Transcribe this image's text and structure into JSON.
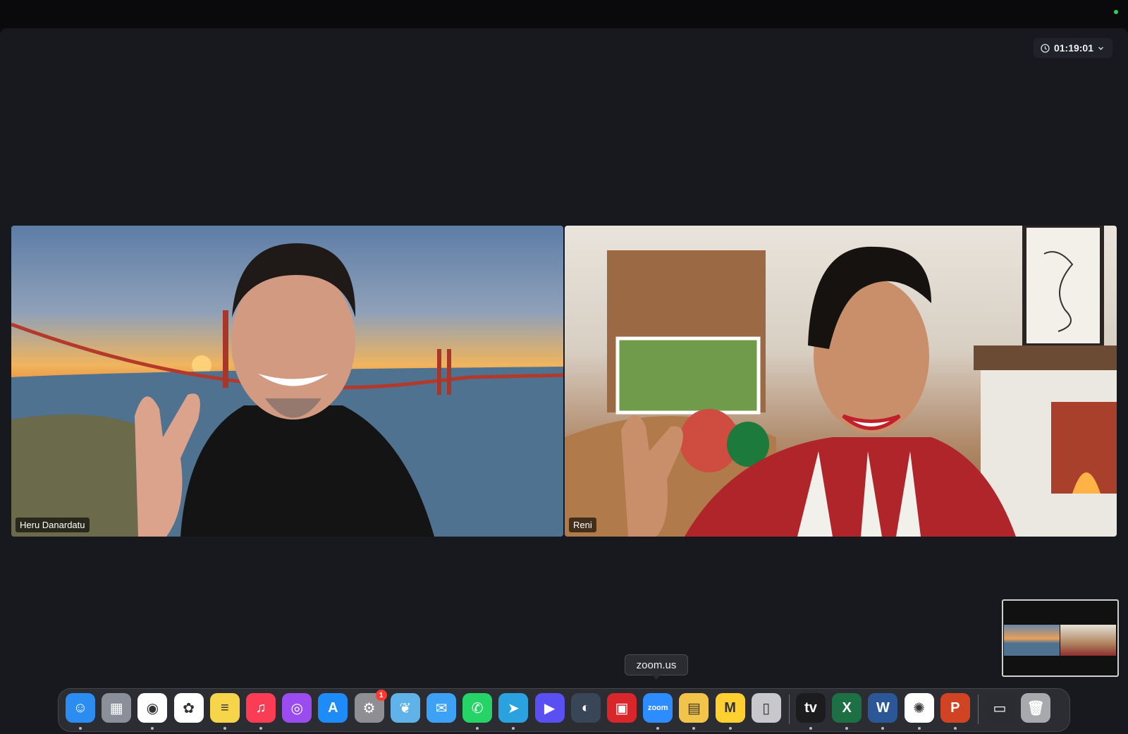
{
  "meeting": {
    "timer": "01:19:01"
  },
  "participants": [
    {
      "name": "Heru Danardatu"
    },
    {
      "name": "Reni"
    }
  ],
  "dock": {
    "tooltip": "zoom.us",
    "settings_badge": "1",
    "zoom_label": "zoom",
    "items": [
      {
        "name": "finder-icon",
        "color": "#2b8cf2"
      },
      {
        "name": "launchpad-icon",
        "color": "#8a8f99"
      },
      {
        "name": "chrome-icon",
        "color": "#ffffff"
      },
      {
        "name": "photos-icon",
        "color": "#ffffff"
      },
      {
        "name": "notes-icon",
        "color": "#f7d54a"
      },
      {
        "name": "music-icon",
        "color": "#fa3c55"
      },
      {
        "name": "podcasts-icon",
        "color": "#9b4cf0"
      },
      {
        "name": "app-store-icon",
        "color": "#1d8cf8"
      },
      {
        "name": "system-settings-icon",
        "color": "#8e8e93"
      },
      {
        "name": "kindle-icon",
        "color": "#5fb3e8"
      },
      {
        "name": "mail-icon",
        "color": "#3da2f5"
      },
      {
        "name": "whatsapp-icon",
        "color": "#25d366"
      },
      {
        "name": "telegram-icon",
        "color": "#2aa2e0"
      },
      {
        "name": "linear-icon",
        "color": "#5a4ff2"
      },
      {
        "name": "quicktime-icon",
        "color": "#384657"
      },
      {
        "name": "photo-booth-icon",
        "color": "#d9262b"
      },
      {
        "name": "zoom-icon",
        "color": "#2d8cff"
      },
      {
        "name": "stickies-icon",
        "color": "#f3c44a"
      },
      {
        "name": "miro-icon",
        "color": "#ffd02f"
      },
      {
        "name": "iphone-mirroring-icon",
        "color": "#c7c7cc"
      },
      {
        "name": "apple-tv-icon",
        "color": "#1c1c1e"
      },
      {
        "name": "excel-icon",
        "color": "#1d7044"
      },
      {
        "name": "word-icon",
        "color": "#2b5797"
      },
      {
        "name": "chatgpt-icon",
        "color": "#ffffff"
      },
      {
        "name": "powerpoint-icon",
        "color": "#d04423"
      },
      {
        "name": "recent-window-icon",
        "color": "#2a2c31"
      },
      {
        "name": "trash-icon",
        "color": "#a7a9ad"
      }
    ]
  }
}
